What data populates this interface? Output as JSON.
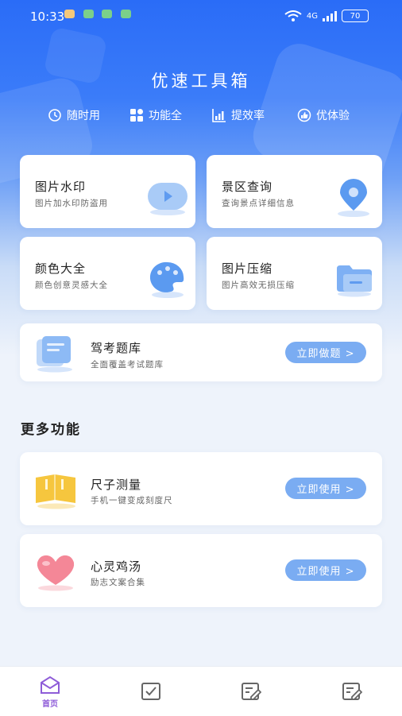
{
  "status": {
    "time": "10:33",
    "network": "4G",
    "battery": "70"
  },
  "app_title": "优速工具箱",
  "features": [
    {
      "label": "随时用",
      "icon": "clock-icon"
    },
    {
      "label": "功能全",
      "icon": "grid-icon"
    },
    {
      "label": "提效率",
      "icon": "bar-chart-icon"
    },
    {
      "label": "优体验",
      "icon": "thumb-up-icon"
    }
  ],
  "tools": [
    {
      "title": "图片水印",
      "subtitle": "图片加水印防盗用",
      "icon": "video-bubble-icon"
    },
    {
      "title": "景区查询",
      "subtitle": "查询景点详细信息",
      "icon": "location-pin-icon"
    },
    {
      "title": "颜色大全",
      "subtitle": "颜色创意灵感大全",
      "icon": "palette-icon"
    },
    {
      "title": "图片压缩",
      "subtitle": "图片高效无损压缩",
      "icon": "folder-icon"
    }
  ],
  "exam": {
    "title": "驾考题库",
    "subtitle": "全面覆盖考试题库",
    "button": "立即做题 >"
  },
  "more_title": "更多功能",
  "more": [
    {
      "title": "尺子测量",
      "subtitle": "手机一键变成刻度尺",
      "button": "立即使用 >",
      "icon": "ruler-book-icon"
    },
    {
      "title": "心灵鸡汤",
      "subtitle": "励志文案合集",
      "button": "立即使用 >",
      "icon": "heart-icon"
    }
  ],
  "tabbar": {
    "home_label": "首页"
  },
  "colors": {
    "primary": "#2a6cf7",
    "button": "#7aacf2",
    "tab_active": "#8e5cd8"
  }
}
